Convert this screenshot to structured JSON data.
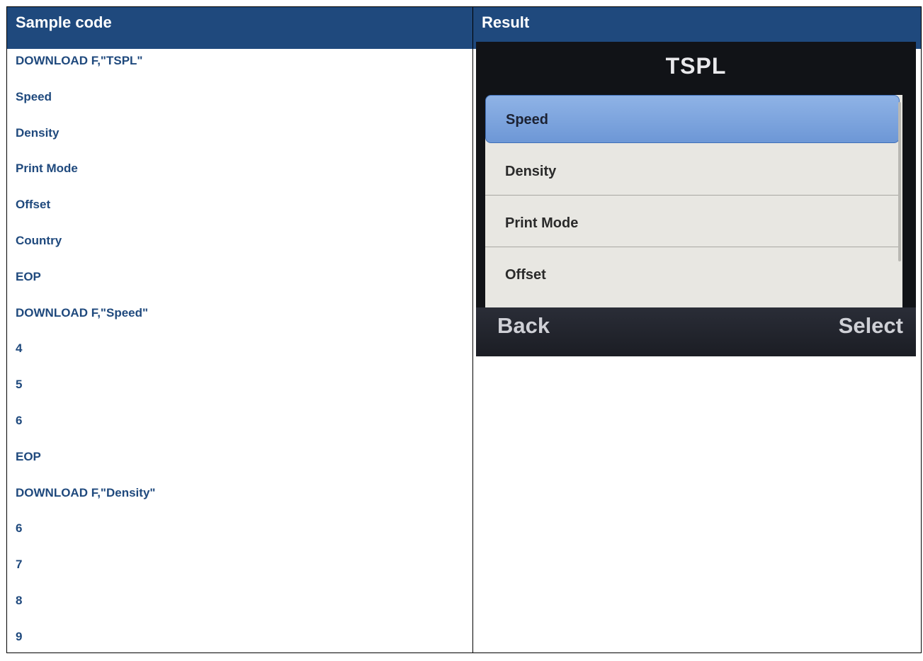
{
  "table": {
    "header_left": "Sample code",
    "header_right": "Result"
  },
  "code_lines": [
    "DOWNLOAD F,\"TSPL\"",
    "Speed",
    "Density",
    "Print Mode",
    "Offset",
    "Country",
    "EOP",
    "DOWNLOAD F,\"Speed\"",
    "4",
    "5",
    "6",
    "EOP",
    "DOWNLOAD F,\"Density\"",
    "6",
    "7",
    "8",
    "9"
  ],
  "device": {
    "title": "TSPL",
    "menu_items": [
      "Speed",
      "Density",
      "Print Mode",
      "Offset"
    ],
    "selected_index": 0,
    "softkey_left": "Back",
    "softkey_right": "Select"
  },
  "colors": {
    "header_bg": "#1f497d",
    "code_text": "#1f497d",
    "selection": "#7aa3df"
  }
}
